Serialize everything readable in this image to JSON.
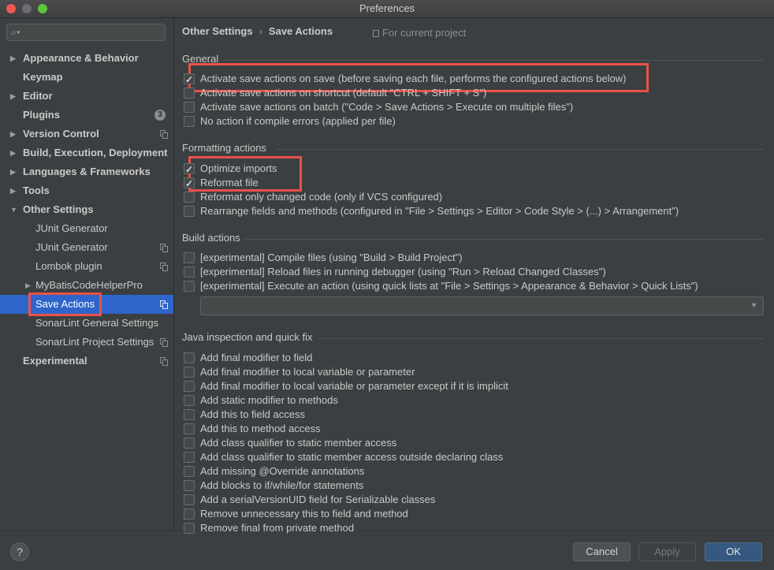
{
  "window": {
    "title": "Preferences"
  },
  "sidebar": {
    "search_placeholder": "",
    "items": [
      {
        "label": "Appearance & Behavior",
        "arrow": "▶"
      },
      {
        "label": "Keymap"
      },
      {
        "label": "Editor",
        "arrow": "▶"
      },
      {
        "label": "Plugins",
        "badge": "3"
      },
      {
        "label": "Version Control",
        "arrow": "▶"
      },
      {
        "label": "Build, Execution, Deployment",
        "arrow": "▶"
      },
      {
        "label": "Languages & Frameworks",
        "arrow": "▶"
      },
      {
        "label": "Tools",
        "arrow": "▶"
      },
      {
        "label": "Other Settings",
        "arrow": "▼"
      },
      {
        "label": "JUnit Generator"
      },
      {
        "label": "JUnit Generator"
      },
      {
        "label": "Lombok plugin"
      },
      {
        "label": "MyBatisCodeHelperPro",
        "arrow": "▶"
      },
      {
        "label": "Save Actions"
      },
      {
        "label": "SonarLint General Settings"
      },
      {
        "label": "SonarLint Project Settings"
      },
      {
        "label": "Experimental"
      }
    ]
  },
  "breadcrumb": {
    "parent": "Other Settings",
    "separator": "›",
    "current": "Save Actions"
  },
  "scope_label": "For current project",
  "sections": {
    "general": {
      "title": "General",
      "options": [
        {
          "label": "Activate save actions on save (before saving each file, performs the configured actions below)",
          "checked": true
        },
        {
          "label": "Activate save actions on shortcut (default \"CTRL + SHIFT + S\")",
          "checked": false
        },
        {
          "label": "Activate save actions on batch (\"Code > Save Actions > Execute on multiple files\")",
          "checked": false
        },
        {
          "label": "No action if compile errors (applied per file)",
          "checked": false
        }
      ]
    },
    "formatting": {
      "title": "Formatting actions",
      "options": [
        {
          "label": "Optimize imports",
          "checked": true
        },
        {
          "label": "Reformat file",
          "checked": true
        },
        {
          "label": "Reformat only changed code (only if VCS configured)",
          "checked": false
        },
        {
          "label": "Rearrange fields and methods (configured in \"File > Settings > Editor > Code Style > (...) > Arrangement\")",
          "checked": false
        }
      ]
    },
    "build": {
      "title": "Build actions",
      "options": [
        {
          "label": "[experimental] Compile files (using \"Build > Build Project\")",
          "checked": false
        },
        {
          "label": "[experimental] Reload files in running debugger (using \"Run > Reload Changed Classes\")",
          "checked": false
        },
        {
          "label": "[experimental] Execute an action (using quick lists at \"File > Settings > Appearance & Behavior > Quick Lists\")",
          "checked": false
        }
      ],
      "combo_value": ""
    },
    "java": {
      "title": "Java inspection and quick fix",
      "options": [
        {
          "label": "Add final modifier to field",
          "checked": false
        },
        {
          "label": "Add final modifier to local variable or parameter",
          "checked": false
        },
        {
          "label": "Add final modifier to local variable or parameter except if it is implicit",
          "checked": false
        },
        {
          "label": "Add static modifier to methods",
          "checked": false
        },
        {
          "label": "Add this to field access",
          "checked": false
        },
        {
          "label": "Add this to method access",
          "checked": false
        },
        {
          "label": "Add class qualifier to static member access",
          "checked": false
        },
        {
          "label": "Add class qualifier to static member access outside declaring class",
          "checked": false
        },
        {
          "label": "Add missing @Override annotations",
          "checked": false
        },
        {
          "label": "Add blocks to if/while/for statements",
          "checked": false
        },
        {
          "label": "Add a serialVersionUID field for Serializable classes",
          "checked": false
        },
        {
          "label": "Remove unnecessary this to field and method",
          "checked": false
        },
        {
          "label": "Remove final from private method",
          "checked": false
        }
      ]
    }
  },
  "footer": {
    "help": "?",
    "cancel": "Cancel",
    "apply": "Apply",
    "ok": "OK"
  },
  "colors": {
    "highlight": "#ea5148",
    "selection": "#2f65ca",
    "ok_button": "#365880"
  }
}
